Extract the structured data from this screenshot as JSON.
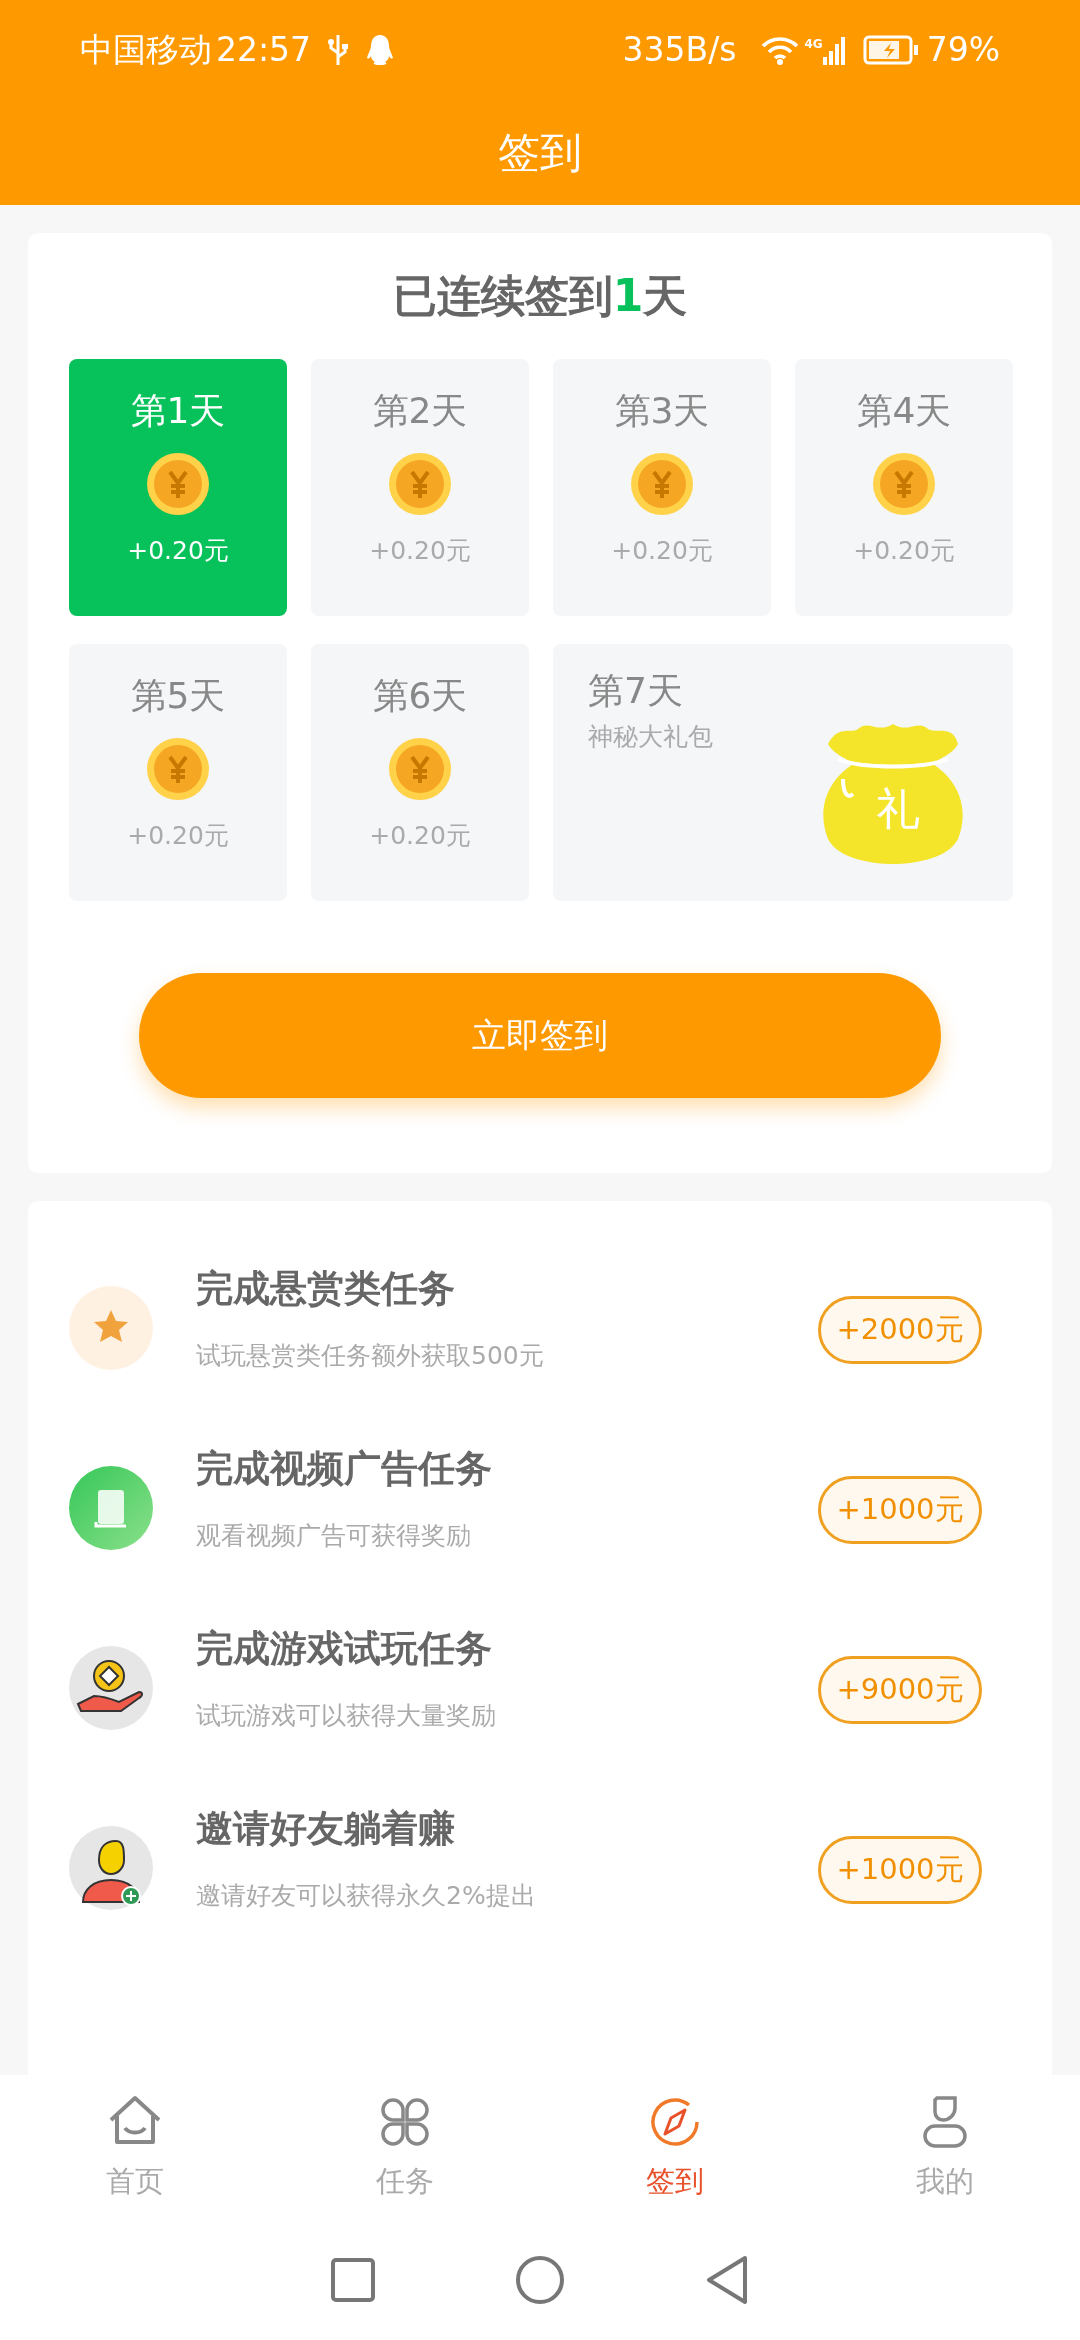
{
  "status_bar": {
    "carrier": "中国移动",
    "time": "22:57",
    "speed": "335B/s",
    "network": "4G",
    "battery": "79%"
  },
  "header": {
    "title": "签到"
  },
  "streak": {
    "prefix": "已连续签到",
    "count": "1",
    "suffix": "天"
  },
  "days": [
    {
      "kind": "coin",
      "label": "第1天",
      "reward": "+0.20元",
      "checked": true
    },
    {
      "kind": "coin",
      "label": "第2天",
      "reward": "+0.20元",
      "checked": false
    },
    {
      "kind": "coin",
      "label": "第3天",
      "reward": "+0.20元",
      "checked": false
    },
    {
      "kind": "coin",
      "label": "第4天",
      "reward": "+0.20元",
      "checked": false
    },
    {
      "kind": "coin",
      "label": "第5天",
      "reward": "+0.20元",
      "checked": false
    },
    {
      "kind": "coin",
      "label": "第6天",
      "reward": "+0.20元",
      "checked": false
    },
    {
      "kind": "gift",
      "label": "第7天",
      "reward": "神秘大礼包",
      "gift_label": "礼",
      "checked": false
    }
  ],
  "signin_button": "立即签到",
  "tasks": [
    {
      "kind": "star",
      "title": "完成悬赏类任务",
      "desc": "试玩悬赏类任务额外获取500元",
      "reward": "+2000元"
    },
    {
      "kind": "book",
      "title": "完成视频广告任务",
      "desc": "观看视频广告可获得奖励",
      "reward": "+1000元"
    },
    {
      "kind": "game",
      "title": "完成游戏试玩任务",
      "desc": "试玩游戏可以获得大量奖励",
      "reward": "+9000元"
    },
    {
      "kind": "invite",
      "title": "邀请好友躺着赚",
      "desc": "邀请好友可以获得永久2%提出",
      "reward": "+1000元"
    }
  ],
  "tabbar": [
    {
      "kind": "home",
      "label": "首页",
      "selected": false
    },
    {
      "kind": "tasks",
      "label": "任务",
      "selected": false
    },
    {
      "kind": "signin",
      "label": "签到",
      "selected": true
    },
    {
      "kind": "me",
      "label": "我的",
      "selected": false
    }
  ]
}
